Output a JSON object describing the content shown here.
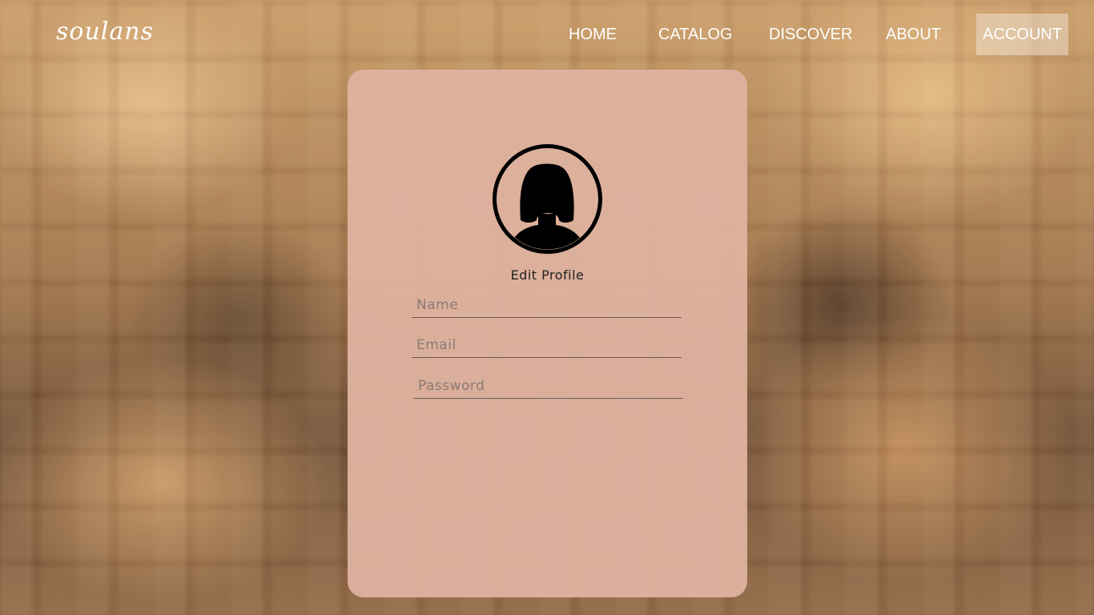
{
  "brand": {
    "logo_text": "soulans"
  },
  "nav": {
    "items": [
      {
        "label": "HOME"
      },
      {
        "label": "CATALOG"
      },
      {
        "label": "DISCOVER"
      },
      {
        "label": "ABOUT"
      },
      {
        "label": "ACCOUNT",
        "active": true
      }
    ]
  },
  "profile_card": {
    "avatar_icon": "user-avatar-icon",
    "title": "Edit Profile",
    "fields": {
      "name": {
        "placeholder": "Name",
        "value": ""
      },
      "email": {
        "placeholder": "Email",
        "value": ""
      },
      "password": {
        "placeholder": "Password",
        "value": ""
      }
    }
  },
  "colors": {
    "card_background": "#deb29e",
    "nav_text": "#ffffff",
    "active_nav_background": "rgba(255,255,255,0.35)"
  }
}
